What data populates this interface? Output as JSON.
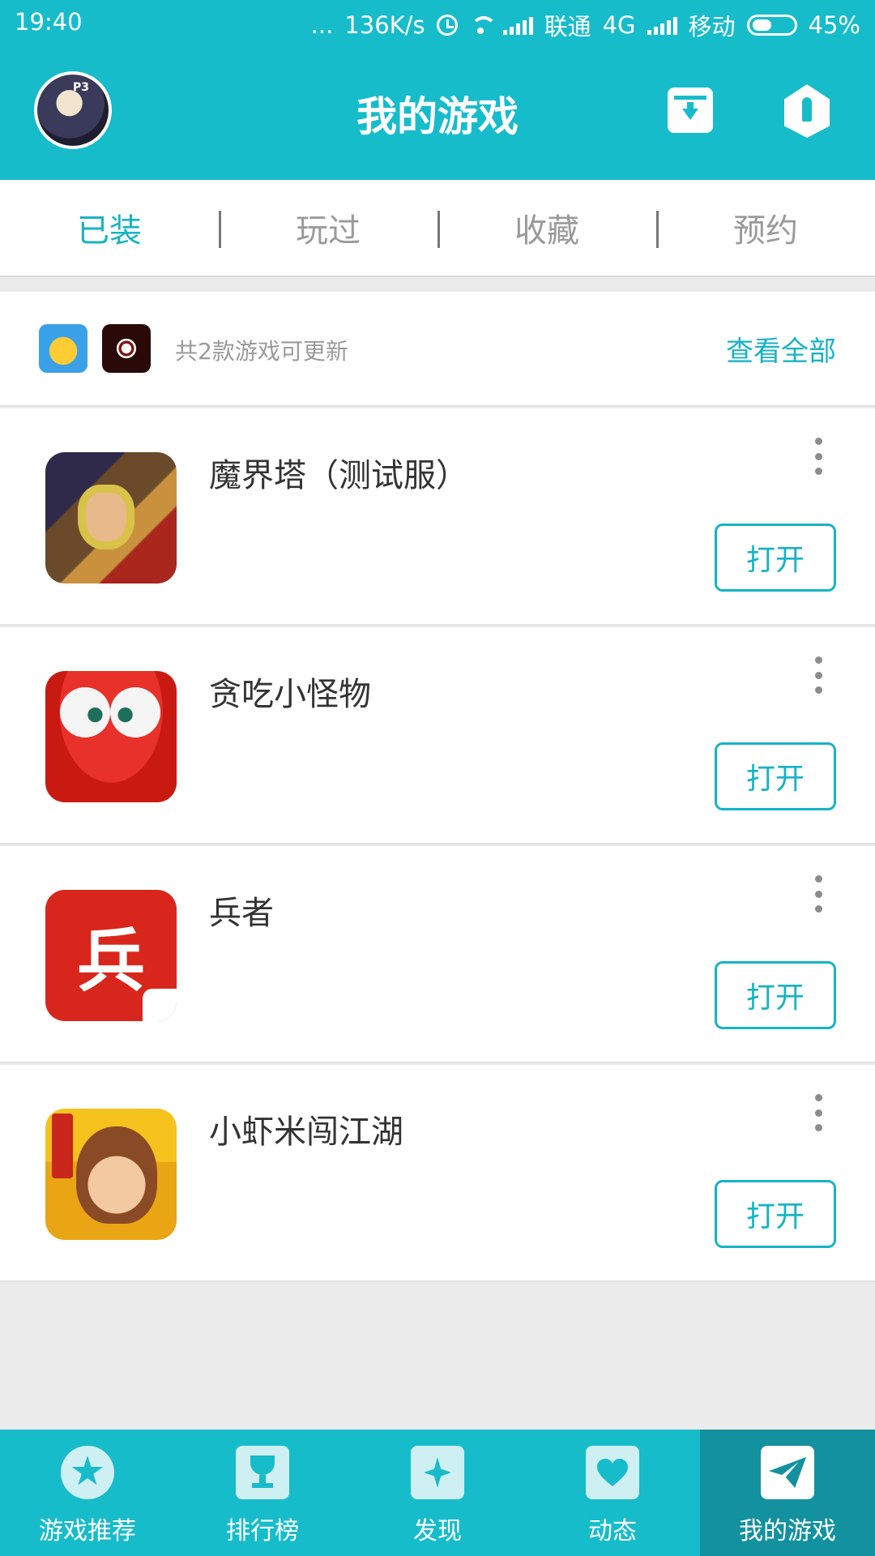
{
  "status_bar": {
    "time": "19:40",
    "dots": "...",
    "speed": "136K/s",
    "carrier1": "联通",
    "network": "4G",
    "carrier2": "移动",
    "battery": "45%",
    "battery_level": 0.45
  },
  "header": {
    "title": "我的游戏",
    "avatar_text": "P3"
  },
  "tabs": [
    {
      "label": "已装",
      "active": true
    },
    {
      "label": "玩过",
      "active": false
    },
    {
      "label": "收藏",
      "active": false
    },
    {
      "label": "预约",
      "active": false
    }
  ],
  "update_bar": {
    "text": "共2款游戏可更新",
    "link": "查看全部"
  },
  "games": [
    {
      "name": "魔界塔（测试服）",
      "button": "打开"
    },
    {
      "name": "贪吃小怪物",
      "button": "打开"
    },
    {
      "name": "兵者",
      "button": "打开",
      "icon_char": "兵"
    },
    {
      "name": "小虾米闯江湖",
      "button": "打开"
    }
  ],
  "bottom_nav": [
    {
      "label": "游戏推荐",
      "icon": "star-icon"
    },
    {
      "label": "排行榜",
      "icon": "trophy-icon"
    },
    {
      "label": "发现",
      "icon": "sparkle-icon"
    },
    {
      "label": "动态",
      "icon": "heart-icon"
    },
    {
      "label": "我的游戏",
      "icon": "paper-plane-icon",
      "active": true
    }
  ],
  "colors": {
    "accent": "#17bccb",
    "accent_text": "#17b3c4",
    "nav_active": "#13919e"
  }
}
